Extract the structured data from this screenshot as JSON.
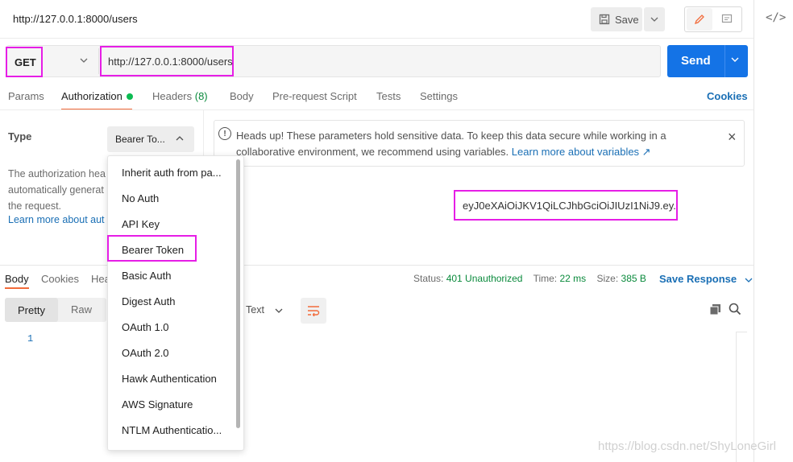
{
  "request": {
    "title": "http://127.0.0.1:8000/users",
    "save_label": "Save",
    "method": "GET",
    "url": "http://127.0.0.1:8000/users",
    "send_label": "Send"
  },
  "tabs": [
    {
      "label": "Params"
    },
    {
      "label": "Authorization"
    },
    {
      "label": "Headers (8)"
    },
    {
      "label": "Body"
    },
    {
      "label": "Pre-request Script"
    },
    {
      "label": "Tests"
    },
    {
      "label": "Settings"
    }
  ],
  "cookies_link": "Cookies",
  "auth": {
    "type_label": "Type",
    "selected_type": "Bearer To...",
    "description_lines": [
      "The authorization hea",
      "automatically generat",
      "the request."
    ],
    "learn_more": "Learn more about aut",
    "notice": "Heads up! These parameters hold sensitive data. To keep this data secure while working in a collaborative environment, we recommend using variables.",
    "notice_link": "Learn more about variables ↗",
    "token": "eyJ0eXAiOiJKV1QiLCJhbGciOiJIUzI1NiJ9.ey..."
  },
  "dropdown": {
    "items": [
      "Inherit auth from pa...",
      "No Auth",
      "API Key",
      "Bearer Token",
      "Basic Auth",
      "Digest Auth",
      "OAuth 1.0",
      "OAuth 2.0",
      "Hawk Authentication",
      "AWS Signature",
      "NTLM Authenticatio..."
    ]
  },
  "response": {
    "tabs": [
      "Body",
      "Cookies",
      "Hea"
    ],
    "status_label": "Status:",
    "status_value": "401 Unauthorized",
    "time_label": "Time:",
    "time_value": "22 ms",
    "size_label": "Size:",
    "size_value": "385 B",
    "save_response": "Save Response",
    "pretty": "Pretty",
    "raw": "Raw",
    "format": "Text",
    "line_number": "1"
  },
  "watermark": "https://blog.csdn.net/ShyLoneGirl",
  "colors": {
    "accent": "#1473e6",
    "highlight": "#e61ee6",
    "active_tab": "#f26b3a",
    "ok_dot": "#0cbb52"
  }
}
